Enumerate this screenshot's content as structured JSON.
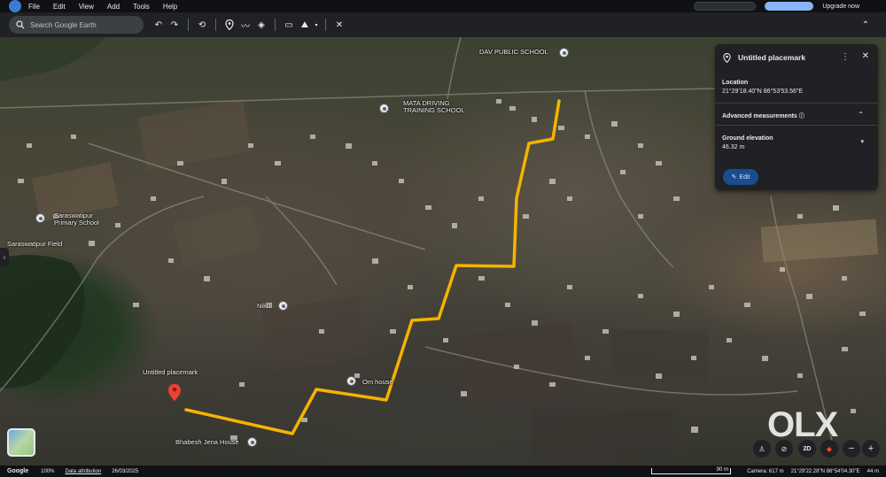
{
  "menu": {
    "items": [
      "File",
      "Edit",
      "View",
      "Add",
      "Tools",
      "Help"
    ],
    "upgrade": "Upgrade now"
  },
  "search": {
    "placeholder": "Search Google Earth"
  },
  "map_labels": {
    "dav_school": "DAV PUBLIC SCHOOL",
    "mata_driving": "MATA DRIVING\nTRAINING SCHOOL",
    "saraswatipur_school": "Saraswatipur\nPrimary School",
    "saraswatipur_field": "Saraswatipur Field",
    "niku": "Niku",
    "om_house": "Om house",
    "untitled": "Untitled placemark",
    "bhabesh": "Bhabesh Jena House"
  },
  "panel": {
    "title": "Untitled placemark",
    "location_label": "Location",
    "location_value": "21°29'18.40\"N 86°53'53.56\"E",
    "advanced_label": "Advanced measurements",
    "elevation_label": "Ground elevation",
    "elevation_value": "46.32 m",
    "edit_label": "Edit"
  },
  "controls": {
    "mode_2d": "2D"
  },
  "watermark": "OLX",
  "status": {
    "brand": "Google",
    "zoom": "100%",
    "attribution": "Data attribution",
    "date": "26/03/2025",
    "scale": "90 m",
    "camera": "Camera: 617 m",
    "coords": "21°29'22.28\"N 86°54'04.30\"E",
    "alt": "44 m"
  },
  "colors": {
    "route": "#f4b400",
    "pin": "#ea4335",
    "panel_bg": "#202124",
    "accent": "#8ab4f8"
  }
}
